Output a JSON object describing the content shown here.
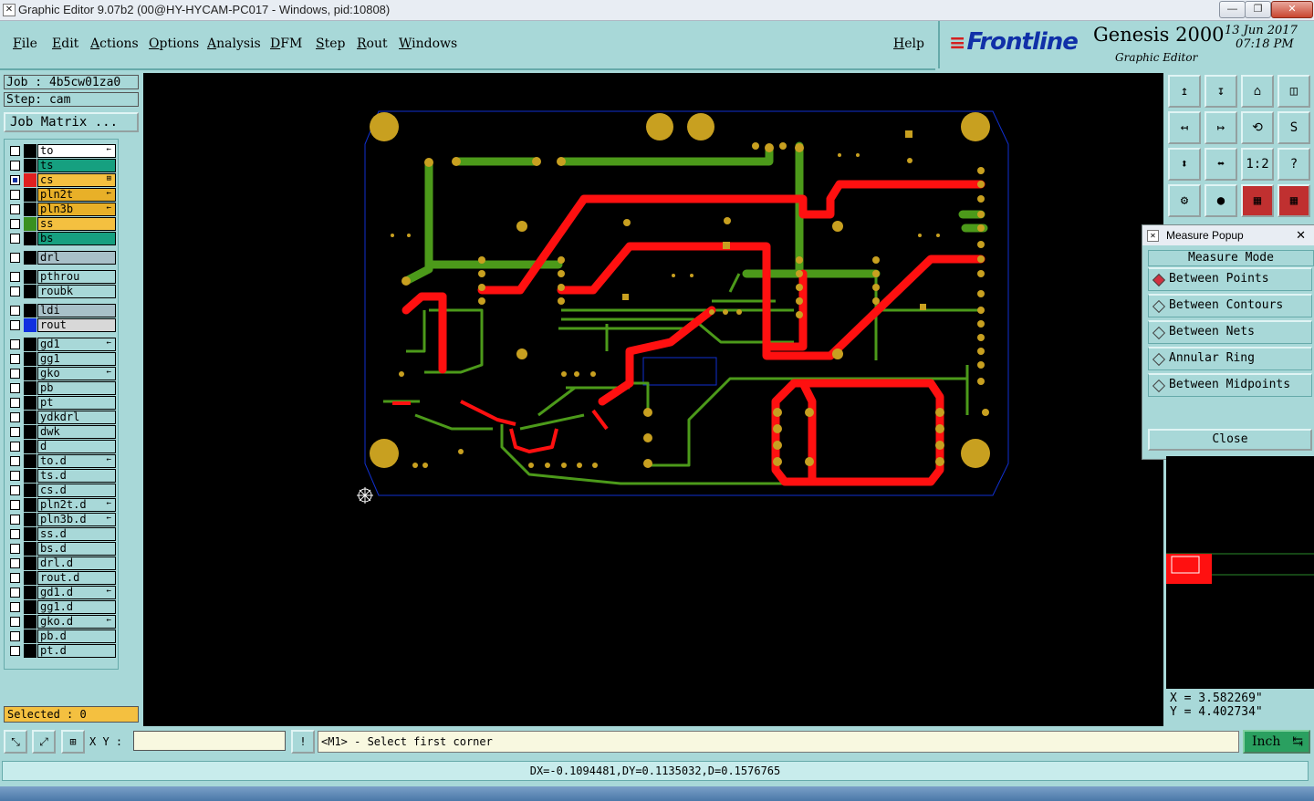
{
  "window": {
    "title": "Graphic Editor 9.07b2 (00@HY-HYCAM-PC017 - Windows, pid:10808)",
    "min": "—",
    "max": "❐",
    "close": "✕"
  },
  "menu": [
    "File",
    "Edit",
    "Actions",
    "Options",
    "Analysis",
    "DFM",
    "Step",
    "Rout",
    "Windows"
  ],
  "help": "Help",
  "brand": {
    "logo": "Frontline",
    "product": "Genesis 2000",
    "subtitle": "Graphic Editor",
    "date": "13 Jun 2017",
    "time": "07:18 PM"
  },
  "job": {
    "job_label": "Job : 4b5cw01za0",
    "step_label": "Step: cam",
    "matrix_button": "Job Matrix ..."
  },
  "layers": [
    {
      "name": "to",
      "swatch": "#000000",
      "bg": "#ffffff",
      "mark": "←"
    },
    {
      "name": "ts",
      "swatch": "#000000",
      "bg": "#16a080",
      "mark": ""
    },
    {
      "name": "cs",
      "swatch": "#e02020",
      "bg": "#f4c040",
      "mark": "⊞",
      "checked": true
    },
    {
      "name": "pln2t",
      "swatch": "#000000",
      "bg": "#e8b028",
      "mark": "←"
    },
    {
      "name": "pln3b",
      "swatch": "#000000",
      "bg": "#e8b028",
      "mark": "←"
    },
    {
      "name": "ss",
      "swatch": "#3a9020",
      "bg": "#f4c040",
      "mark": ""
    },
    {
      "name": "bs",
      "swatch": "#000000",
      "bg": "#16a080",
      "mark": ""
    },
    {
      "name": "drl",
      "swatch": "#000000",
      "bg": "#a8c0c8",
      "mark": ""
    },
    {
      "name": "pthrou",
      "swatch": "#000000",
      "bg": "#a8d8d8",
      "mark": ""
    },
    {
      "name": "roubk",
      "swatch": "#000000",
      "bg": "#a8d8d8",
      "mark": ""
    },
    {
      "name": "ldi",
      "swatch": "#000000",
      "bg": "#a8c0c8",
      "mark": ""
    },
    {
      "name": "rout",
      "swatch": "#1030e0",
      "bg": "#d8d8d8",
      "mark": ""
    },
    {
      "name": "gd1",
      "swatch": "#000000",
      "bg": "#a8d8d8",
      "mark": "←"
    },
    {
      "name": "gg1",
      "swatch": "#000000",
      "bg": "#a8d8d8",
      "mark": ""
    },
    {
      "name": "gko",
      "swatch": "#000000",
      "bg": "#a8d8d8",
      "mark": "←"
    },
    {
      "name": "pb",
      "swatch": "#000000",
      "bg": "#a8d8d8",
      "mark": ""
    },
    {
      "name": "pt",
      "swatch": "#000000",
      "bg": "#a8d8d8",
      "mark": ""
    },
    {
      "name": "ydkdrl",
      "swatch": "#000000",
      "bg": "#a8d8d8",
      "mark": ""
    },
    {
      "name": "dwk",
      "swatch": "#000000",
      "bg": "#a8d8d8",
      "mark": ""
    },
    {
      "name": "d",
      "swatch": "#000000",
      "bg": "#a8d8d8",
      "mark": ""
    },
    {
      "name": "to.d",
      "swatch": "#000000",
      "bg": "#a8d8d8",
      "mark": "←"
    },
    {
      "name": "ts.d",
      "swatch": "#000000",
      "bg": "#a8d8d8",
      "mark": ""
    },
    {
      "name": "cs.d",
      "swatch": "#000000",
      "bg": "#a8d8d8",
      "mark": ""
    },
    {
      "name": "pln2t.d",
      "swatch": "#000000",
      "bg": "#a8d8d8",
      "mark": "←"
    },
    {
      "name": "pln3b.d",
      "swatch": "#000000",
      "bg": "#a8d8d8",
      "mark": "←"
    },
    {
      "name": "ss.d",
      "swatch": "#000000",
      "bg": "#a8d8d8",
      "mark": ""
    },
    {
      "name": "bs.d",
      "swatch": "#000000",
      "bg": "#a8d8d8",
      "mark": ""
    },
    {
      "name": "drl.d",
      "swatch": "#000000",
      "bg": "#a8d8d8",
      "mark": ""
    },
    {
      "name": "rout.d",
      "swatch": "#000000",
      "bg": "#a8d8d8",
      "mark": ""
    },
    {
      "name": "gd1.d",
      "swatch": "#000000",
      "bg": "#a8d8d8",
      "mark": "←"
    },
    {
      "name": "gg1.d",
      "swatch": "#000000",
      "bg": "#a8d8d8",
      "mark": ""
    },
    {
      "name": "gko.d",
      "swatch": "#000000",
      "bg": "#a8d8d8",
      "mark": "←"
    },
    {
      "name": "pb.d",
      "swatch": "#000000",
      "bg": "#a8d8d8",
      "mark": ""
    },
    {
      "name": "pt.d",
      "swatch": "#000000",
      "bg": "#a8d8d8",
      "mark": ""
    }
  ],
  "selected_label": "Selected : 0",
  "toolbar_icons": [
    "↥",
    "↧",
    "⌂",
    "◫",
    "↤",
    "↦",
    "⟲",
    "S",
    "⬍",
    "⬌",
    "1:2",
    "?",
    "⚙",
    "●",
    "▦",
    "▦"
  ],
  "measure": {
    "title": "Measure Popup",
    "close_x": "✕",
    "header": "Measure Mode",
    "options": [
      "Between Points",
      "Between Contours",
      "Between Nets",
      "Annular Ring",
      "Between Midpoints"
    ],
    "selected_index": 0,
    "close_button": "Close"
  },
  "coords": {
    "x": "X = 3.582269\"",
    "y": "Y = 4.402734\""
  },
  "bottom": {
    "xy_label": "X Y :",
    "xy_value": "",
    "bang": "!",
    "prompt": "<M1> - Select first corner",
    "unit": "Inch",
    "unit_arrow": "↹"
  },
  "status": "DX=-0.1094481,DY=0.1135032,D=0.1576765",
  "colors": {
    "bg": "#a8d8d8",
    "signal_red": "#ff1010",
    "signal_green": "#4c9a1a",
    "pad_gold": "#c8a020",
    "profile": "#1030d0"
  }
}
